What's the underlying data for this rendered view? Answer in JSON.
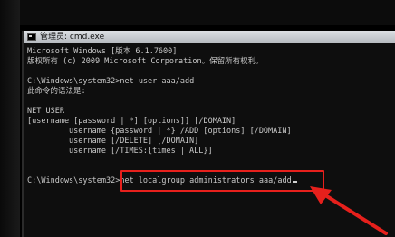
{
  "window": {
    "title": "管理员: cmd.exe"
  },
  "console": {
    "lines": [
      "Microsoft Windows [版本 6.1.7600]",
      "版权所有 (c) 2009 Microsoft Corporation。保留所有权利。",
      "",
      "C:\\Windows\\system32>net user aaa/add",
      "此命令的语法是:",
      "",
      "NET USER",
      "[username [password | *] [options]] [/DOMAIN]",
      "username {password | *} /ADD [options] [/DOMAIN]",
      "username [/DELETE] [/DOMAIN]",
      "username [/TIMES:{times | ALL}]",
      "",
      "",
      "C:\\Windows\\system32>net localgroup administrators aaa/add"
    ]
  },
  "annotation": {
    "highlight_color": "#e6201c"
  }
}
